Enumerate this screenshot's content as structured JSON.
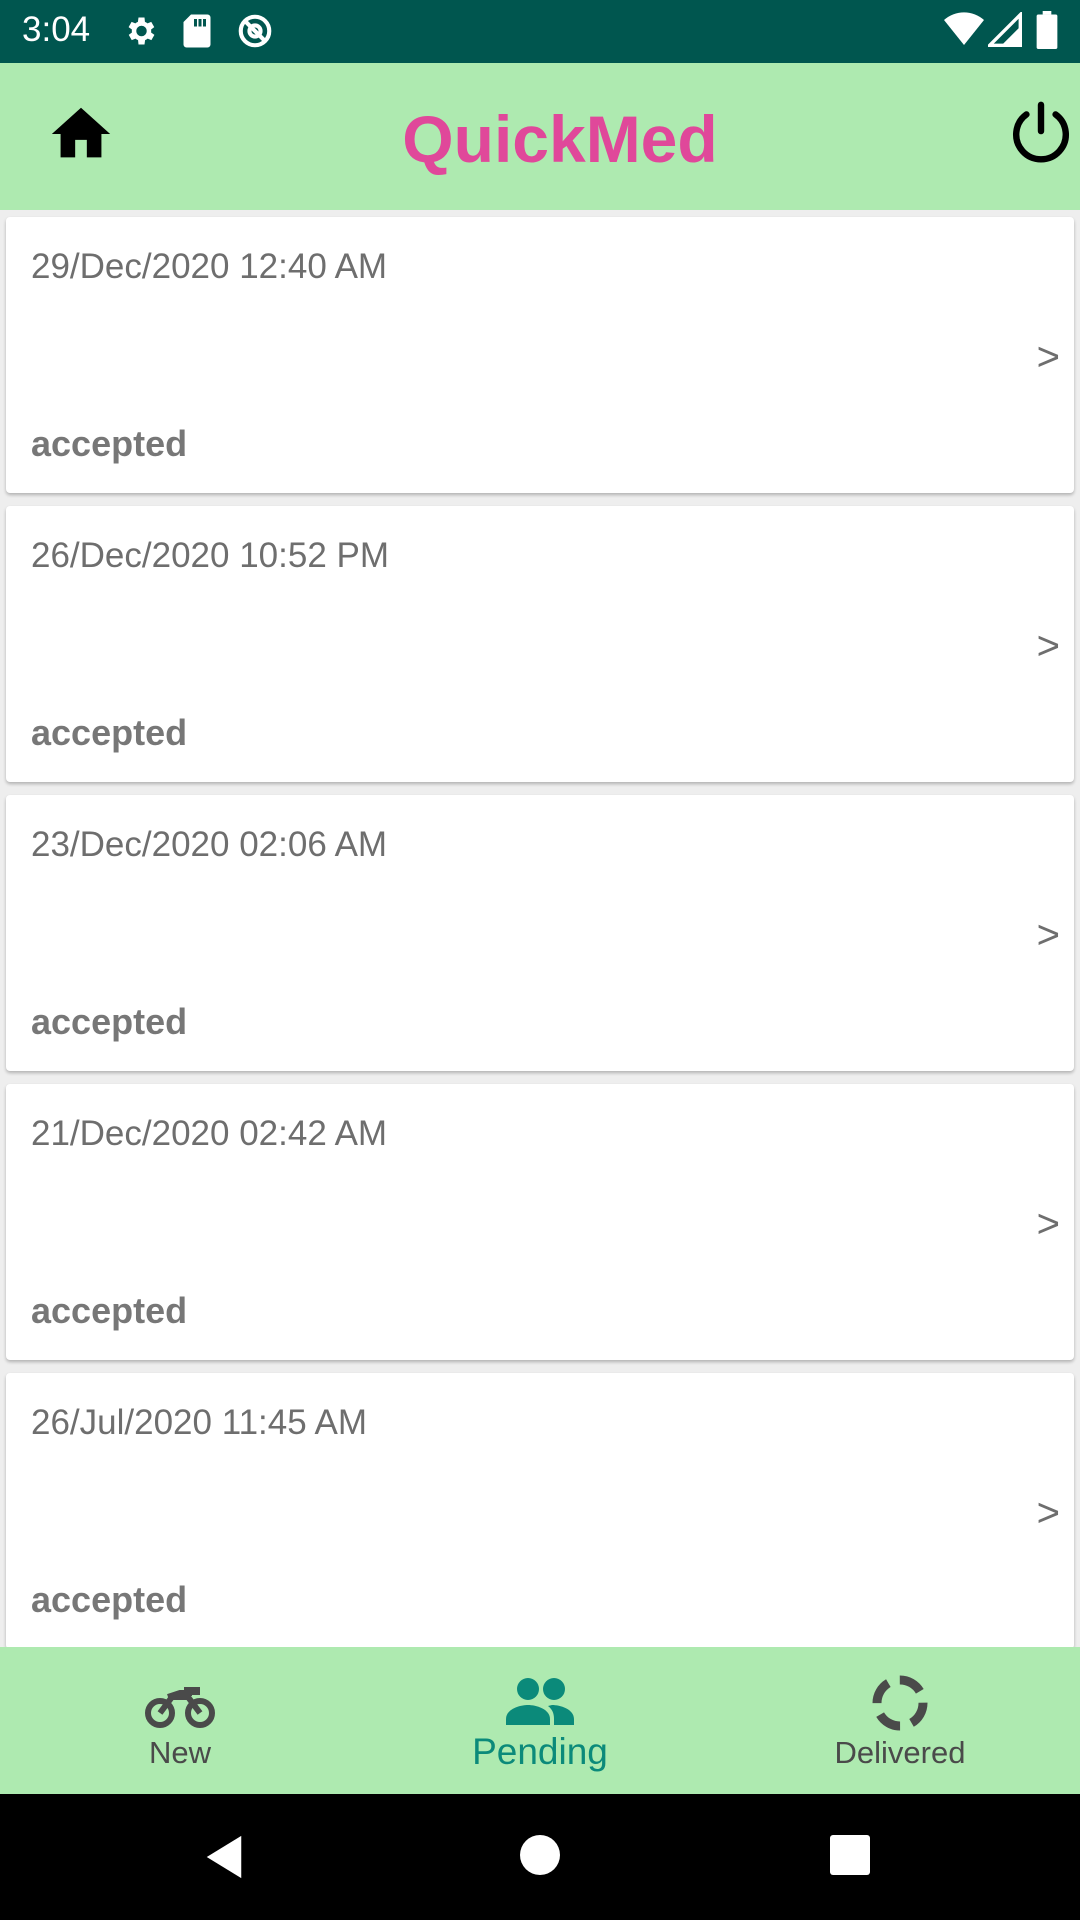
{
  "status_bar": {
    "time": "3:04",
    "icons": [
      "gear-icon",
      "sd-card-icon",
      "at-sign-icon",
      "wifi-icon",
      "signal-icon",
      "battery-icon"
    ]
  },
  "app_bar": {
    "title": "QuickMed",
    "title_color": "#e0489a",
    "background": "#aeeab0",
    "left_icon": "home-icon",
    "right_icon": "power-icon"
  },
  "orders": [
    {
      "date": "29/Dec/2020 12:40 AM",
      "status": "accepted",
      "arrow": ">"
    },
    {
      "date": "26/Dec/2020 10:52 PM",
      "status": "accepted",
      "arrow": ">"
    },
    {
      "date": "23/Dec/2020 02:06 AM",
      "status": "accepted",
      "arrow": ">"
    },
    {
      "date": "21/Dec/2020 02:42 AM",
      "status": "accepted",
      "arrow": ">"
    },
    {
      "date": "26/Jul/2020 11:45 AM",
      "status": "accepted",
      "arrow": ">"
    }
  ],
  "bottom_nav": {
    "items": [
      {
        "label": "New",
        "icon": "motorcycle-icon"
      },
      {
        "label": "Pending",
        "icon": "people-icon",
        "active": true
      },
      {
        "label": "Delivered",
        "icon": "loading-circle-icon"
      }
    ],
    "active_color": "#0b8a7a"
  },
  "system_nav": {
    "icons": [
      "back-icon",
      "home-circle-icon",
      "recents-icon"
    ]
  }
}
